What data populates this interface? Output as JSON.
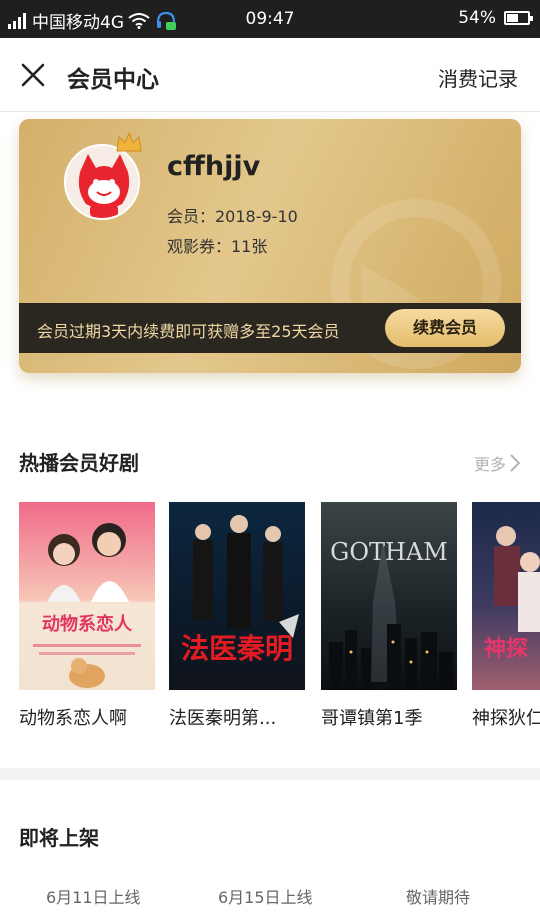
{
  "status_bar": {
    "carrier": "中国移动4G",
    "time": "09:47",
    "battery": "54%",
    "battery_level": 0.54
  },
  "header": {
    "title": "会员中心",
    "records_label": "消费记录"
  },
  "member_card": {
    "username": "cffhjjv",
    "member_label": "会员：2018-9-10",
    "ticket_label": "观影券：11张",
    "promo_text": "会员过期3天内续费即可获赠多至25天会员",
    "renew_button": "续费会员"
  },
  "hot_section": {
    "title": "热播会员好剧",
    "more_label": "更多",
    "items": [
      {
        "title": "动物系恋人啊"
      },
      {
        "title": "法医秦明第..."
      },
      {
        "title": "哥谭镇第1季"
      },
      {
        "title": "神探狄仁"
      }
    ]
  },
  "upcoming_section": {
    "title": "即将上架",
    "tabs": [
      "6月11日上线",
      "6月15日上线",
      "敬请期待"
    ]
  }
}
